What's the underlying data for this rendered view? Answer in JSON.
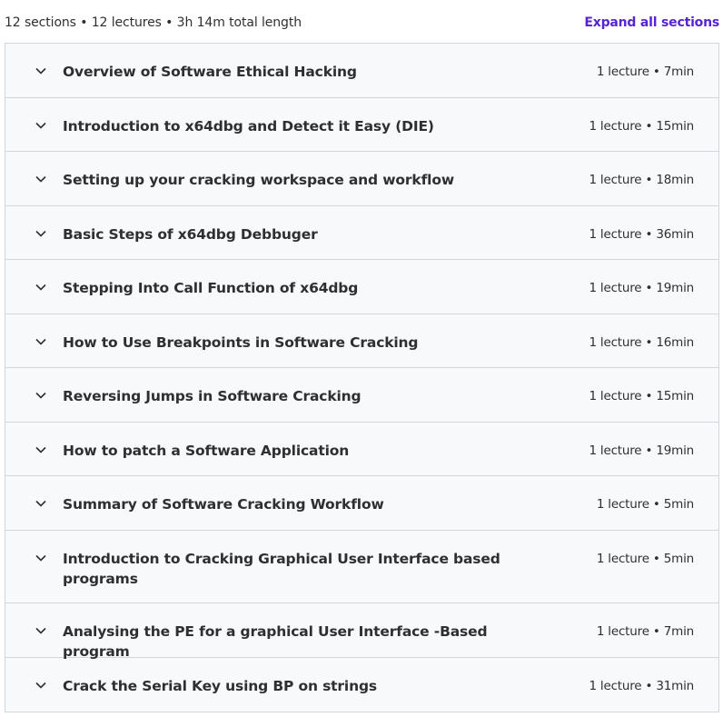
{
  "summary": "12 sections • 12 lectures • 3h 14m total length",
  "expand_label": "Expand all sections",
  "icons": {
    "chevron": "chevron-down-icon"
  },
  "colors": {
    "accent": "#5624d0",
    "section_bg": "#f7f9fa",
    "border": "#d1d7dc",
    "text": "#2d2f31"
  },
  "sections": [
    {
      "title": "Overview of Software Ethical Hacking",
      "content": "1 lecture • 7min"
    },
    {
      "title": "Introduction to x64dbg and Detect it Easy (DIE)",
      "content": "1 lecture • 15min"
    },
    {
      "title": "Setting up your cracking workspace and workflow",
      "content": "1 lecture • 18min"
    },
    {
      "title": "Basic Steps of x64dbg Debbuger",
      "content": "1 lecture • 36min"
    },
    {
      "title": "Stepping Into Call Function of x64dbg",
      "content": "1 lecture • 19min"
    },
    {
      "title": "How to Use Breakpoints in Software Cracking",
      "content": "1 lecture • 16min"
    },
    {
      "title": "Reversing Jumps in Software Cracking",
      "content": "1 lecture • 15min"
    },
    {
      "title": "How to patch a Software Application",
      "content": "1 lecture • 19min"
    },
    {
      "title": "Summary of Software Cracking Workflow",
      "content": "1 lecture • 5min"
    },
    {
      "title": "Introduction to Cracking Graphical User Interface based programs",
      "content": "1 lecture • 5min"
    },
    {
      "title": "Analysing the PE for a graphical User Interface -Based program",
      "content": "1 lecture • 7min"
    },
    {
      "title": "Crack the Serial Key using BP on strings",
      "content": "1 lecture • 31min"
    }
  ]
}
